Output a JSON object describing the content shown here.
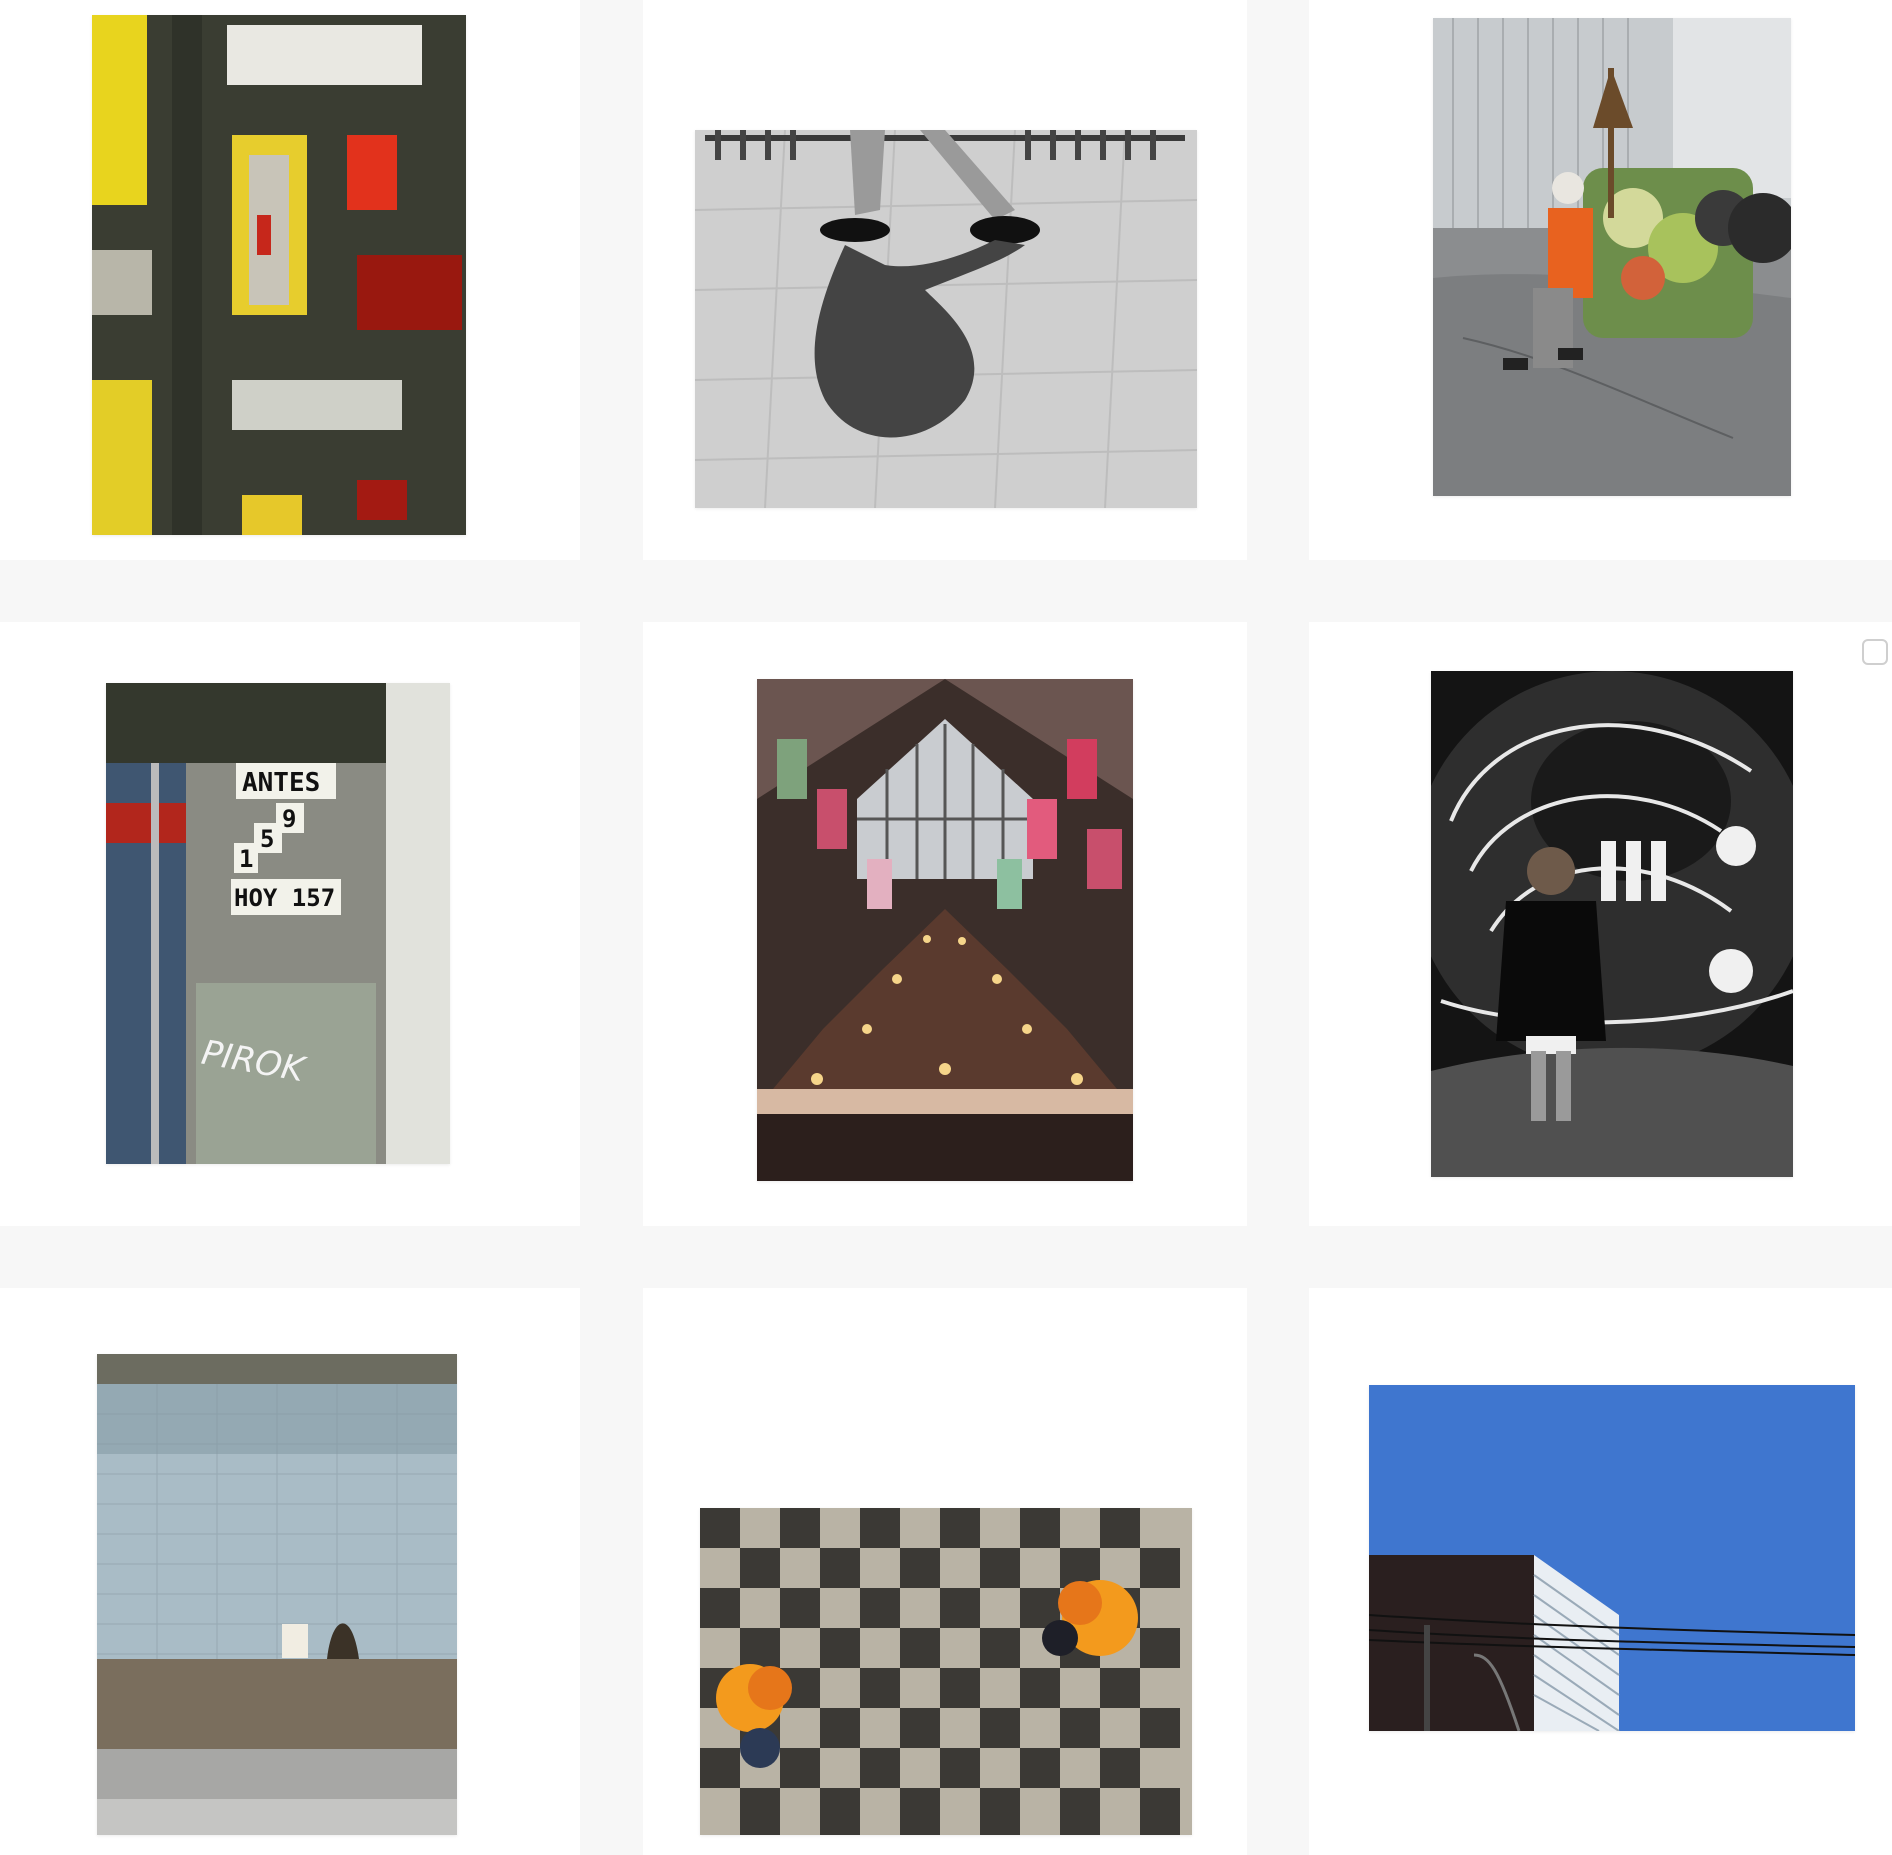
{
  "gallery": {
    "photos": [
      {
        "subject": "colored glass block window",
        "accent": "#e4cf1e"
      },
      {
        "subject": "walking legs and shadow",
        "accent": "#555555"
      },
      {
        "subject": "street sweeper pushing cart",
        "accent": "#e8621f"
      },
      {
        "subject": "number sign on wall",
        "accent": "#6e6e68",
        "sign": {
          "line1": "ANTES",
          "num_a": "1",
          "num_b": "5",
          "num_c": "9",
          "line3": "HOY 157",
          "graffiti": "PIROK"
        }
      },
      {
        "subject": "day of the dead altar",
        "accent": "#f3c26a"
      },
      {
        "subject": "man in front of skeleton mural",
        "accent": "#1a1a1a"
      },
      {
        "subject": "tiled wall with bucket",
        "accent": "#9fb2bd"
      },
      {
        "subject": "people carrying marigolds on checker floor",
        "accent": "#f39a1d"
      },
      {
        "subject": "building against blue sky",
        "accent": "#3f76cf"
      }
    ]
  }
}
